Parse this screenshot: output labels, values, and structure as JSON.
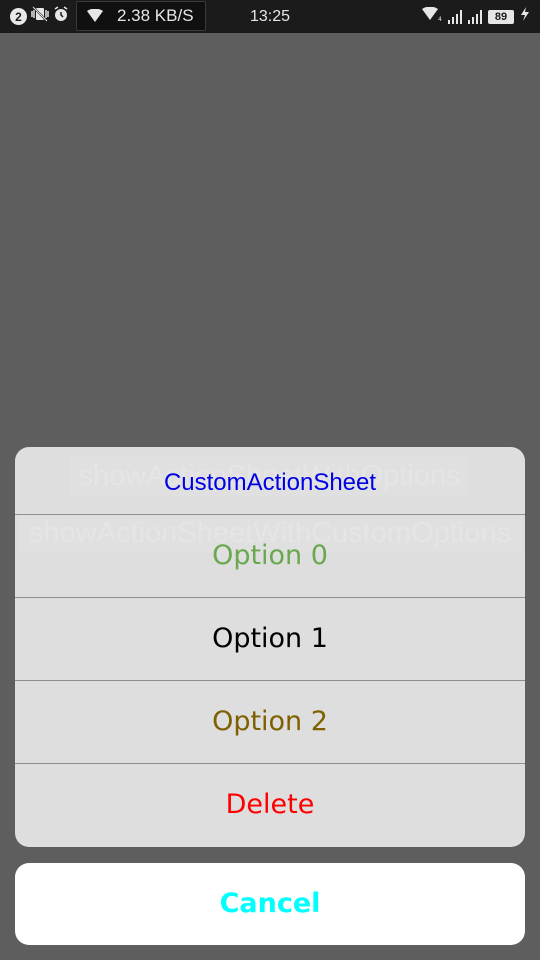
{
  "status_bar": {
    "notification_count": "2",
    "network_speed": "2.38 KB/S",
    "time": "13:25",
    "battery": "89",
    "icons": [
      "notification-count-icon",
      "vibrate-off-icon",
      "alarm-icon",
      "wifi-icon",
      "hotspot-wifi-icon",
      "signal-icon",
      "signal-icon",
      "battery-icon",
      "charging-icon"
    ]
  },
  "background": {
    "button1_label": "showActionSheetWithOptions",
    "button2_label": "showActionSheetWithCustomOptions"
  },
  "action_sheet": {
    "title": "CustomActionSheet",
    "title_color": "#0000e6",
    "options": [
      {
        "label": "Option 0",
        "color": "#6aa84f"
      },
      {
        "label": "Option 1",
        "color": "#000000"
      },
      {
        "label": "Option 2",
        "color": "#7f6000"
      },
      {
        "label": "Delete",
        "color": "#ff0000"
      }
    ],
    "cancel_label": "Cancel",
    "cancel_color": "#00ffff"
  }
}
